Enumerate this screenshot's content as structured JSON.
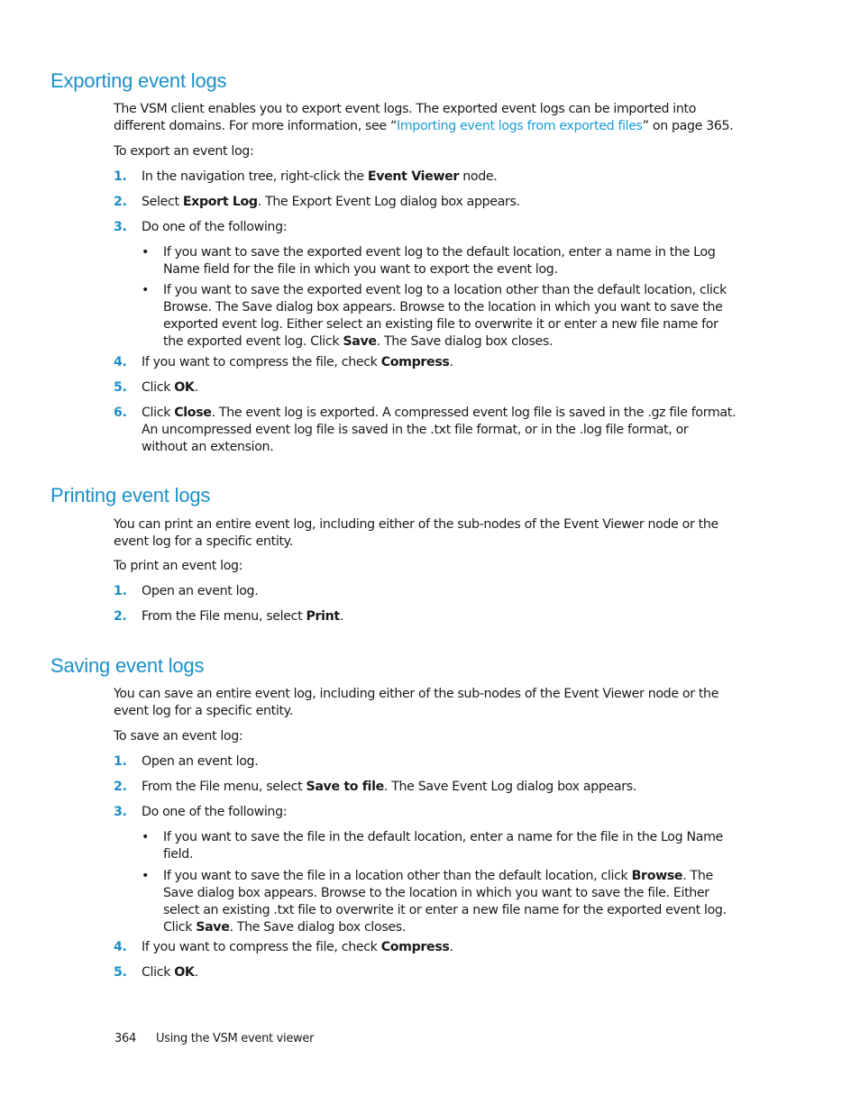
{
  "sections": [
    {
      "heading": "Exporting event logs",
      "intro_parts": [
        "The VSM client enables you to export event logs. The exported event logs can be imported into different domains. For more information, see “",
        "Importing event logs from exported files",
        "” on page 365."
      ],
      "lead": "To export an event log:",
      "steps": [
        {
          "num": "1.",
          "parts": [
            "In the navigation tree, right-click the ",
            "Event Viewer",
            " node."
          ]
        },
        {
          "num": "2.",
          "parts": [
            "Select ",
            "Export Log",
            ". The Export Event Log dialog box appears."
          ]
        },
        {
          "num": "3.",
          "parts": [
            "Do one of the following:"
          ]
        },
        {
          "num": "4.",
          "parts": [
            "If you want to compress the file, check ",
            "Compress",
            "."
          ]
        },
        {
          "num": "5.",
          "parts": [
            "Click ",
            "OK",
            "."
          ]
        },
        {
          "num": "6.",
          "parts": [
            "Click ",
            "Close",
            ". The event log is exported. A compressed event log file is saved in the .gz file format. An uncompressed event log file is saved in the .txt file format, or in the .log file format, or without an extension."
          ]
        }
      ],
      "bullets": [
        {
          "parts": [
            "If you want to save the exported event log to the default location, enter a name in the Log Name field for the file in which you want to export the event log."
          ]
        },
        {
          "parts": [
            "If you want to save the exported event log to a location other than the default location, click Browse. The Save dialog box appears. Browse to the location in which you want to save the exported event log. Either select an existing file to overwrite it or enter a new file name for the exported event log. Click ",
            "Save",
            ". The Save dialog box closes."
          ]
        }
      ]
    },
    {
      "heading": "Printing event logs",
      "intro": "You can print an entire event log, including either of the sub-nodes of the Event Viewer node or the event log for a specific entity.",
      "lead": "To print an event log:",
      "steps": [
        {
          "num": "1.",
          "parts": [
            "Open an event log."
          ]
        },
        {
          "num": "2.",
          "parts": [
            "From the File menu, select ",
            "Print",
            "."
          ]
        }
      ]
    },
    {
      "heading": "Saving event logs",
      "intro": "You can save an entire event log, including either of the sub-nodes of the Event Viewer node or the event log for a specific entity.",
      "lead": "To save an event log:",
      "steps": [
        {
          "num": "1.",
          "parts": [
            "Open an event log."
          ]
        },
        {
          "num": "2.",
          "parts": [
            "From the File menu, select ",
            "Save to file",
            ". The Save Event Log dialog box appears."
          ]
        },
        {
          "num": "3.",
          "parts": [
            "Do one of the following:"
          ]
        },
        {
          "num": "4.",
          "parts": [
            "If you want to compress the file, check ",
            "Compress",
            "."
          ]
        },
        {
          "num": "5.",
          "parts": [
            "Click ",
            "OK",
            "."
          ]
        }
      ],
      "bullets": [
        {
          "parts": [
            "If you want to save the file in the default location, enter a name for the file in the Log Name field."
          ]
        },
        {
          "parts": [
            "If you want to save the file in a location other than the default location, click ",
            "Browse",
            ". The Save dialog box appears. Browse to the location in which you want to save the file. Either select an existing .txt file to overwrite it or enter a new file name for the exported event log. Click ",
            "Save",
            ". The Save dialog box closes."
          ]
        }
      ]
    }
  ],
  "bullet_glyph": "•",
  "footer": {
    "page_number": "364",
    "title": "Using the VSM event viewer"
  }
}
